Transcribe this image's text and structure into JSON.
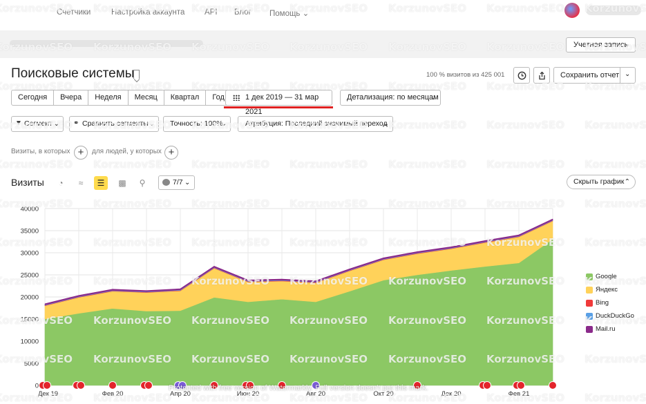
{
  "nav": {
    "items": [
      "Счетчики",
      "Настройка аккаунта",
      "API",
      "Блог",
      "Помощь"
    ],
    "help_chevron": "⌄"
  },
  "account": {
    "button_label": "Учетная запись"
  },
  "header": {
    "title": "Поисковые системы",
    "visits_note": "100 % визитов из 425 001",
    "save_label": "Сохранить отчет"
  },
  "periods": [
    "Сегодня",
    "Вчера",
    "Неделя",
    "Месяц",
    "Квартал",
    "Год"
  ],
  "date_range": "1 дек 2019 — 31 мар 2021",
  "detail_label": "Детализация: по месяцам",
  "filters": {
    "segment": "Сегмент",
    "compare": "Сравнить сегменты",
    "accuracy": "Точность: 100%",
    "attribution": "Атрибуция: Последний значимый переход"
  },
  "segment_row": {
    "visits_text": "Визиты, в которых",
    "people_text": "для людей, у которых"
  },
  "chart_controls": {
    "title": "Визиты",
    "series_count": "7/7",
    "hide_label": "Скрыть график"
  },
  "watermark": {
    "text": "KorzunovSEO",
    "footer": "Protected with free version of Watermarkly. Full version doesn't put this mark."
  },
  "chart_data": {
    "type": "area",
    "stacked": true,
    "x": [
      "2019-12",
      "2020-01",
      "2020-02",
      "2020-03",
      "2020-04",
      "2020-05",
      "2020-06",
      "2020-07",
      "2020-08",
      "2020-09",
      "2020-10",
      "2020-11",
      "2020-12",
      "2021-01",
      "2021-02",
      "2021-03"
    ],
    "xtick_labels": [
      {
        "index": 0,
        "label": "Дек 19"
      },
      {
        "index": 2,
        "label": "Фев 20"
      },
      {
        "index": 4,
        "label": "Апр 20"
      },
      {
        "index": 6,
        "label": "Июн 20"
      },
      {
        "index": 8,
        "label": "Авг 20"
      },
      {
        "index": 10,
        "label": "Окт 20"
      },
      {
        "index": 12,
        "label": "Дек 20"
      },
      {
        "index": 14,
        "label": "Фев 21"
      }
    ],
    "ylim": [
      0,
      40000
    ],
    "yticks": [
      0,
      5000,
      10000,
      15000,
      20000,
      25000,
      30000,
      35000,
      40000
    ],
    "series": [
      {
        "name": "Google",
        "color": "#8cc864",
        "values": [
          15000,
          16300,
          17400,
          16800,
          16900,
          19900,
          18900,
          19500,
          18900,
          21300,
          23800,
          25000,
          26000,
          26900,
          27700,
          33100
        ]
      },
      {
        "name": "Яндекс",
        "color": "#ffd25a",
        "values": [
          3000,
          3600,
          3900,
          4200,
          4500,
          6600,
          4500,
          4100,
          4300,
          4600,
          4600,
          4800,
          4900,
          5400,
          5900,
          4100
        ]
      },
      {
        "name": "Bing",
        "color": "#f03a3a",
        "values": [
          100,
          100,
          100,
          100,
          100,
          100,
          100,
          100,
          100,
          100,
          100,
          100,
          100,
          100,
          100,
          100
        ]
      },
      {
        "name": "DuckDuckGo",
        "color": "#5aa0e6",
        "values": [
          100,
          100,
          100,
          100,
          100,
          100,
          100,
          100,
          100,
          100,
          100,
          100,
          100,
          100,
          100,
          100
        ]
      },
      {
        "name": "Mail.ru",
        "color": "#8a2a8a",
        "values": [
          200,
          200,
          200,
          200,
          200,
          200,
          200,
          200,
          200,
          200,
          200,
          200,
          200,
          200,
          200,
          200
        ]
      }
    ],
    "annotation_markers": [
      {
        "index": 0,
        "count": 2,
        "kind": "red"
      },
      {
        "index": 1,
        "count": 2,
        "kind": "red"
      },
      {
        "index": 2,
        "count": 1,
        "kind": "red"
      },
      {
        "index": 3,
        "count": 2,
        "kind": "red"
      },
      {
        "index": 4,
        "count": 2,
        "kind": "purple"
      },
      {
        "index": 5,
        "count": 1,
        "kind": "red"
      },
      {
        "index": 6,
        "count": 2,
        "kind": "red"
      },
      {
        "index": 7,
        "count": 1,
        "kind": "red"
      },
      {
        "index": 8,
        "count": 1,
        "kind": "purple"
      },
      {
        "index": 11,
        "count": 1,
        "kind": "red"
      },
      {
        "index": 13,
        "count": 2,
        "kind": "red"
      },
      {
        "index": 14,
        "count": 2,
        "kind": "red"
      },
      {
        "index": 15,
        "count": 1,
        "kind": "red"
      }
    ],
    "grid": true,
    "legend": "right"
  }
}
